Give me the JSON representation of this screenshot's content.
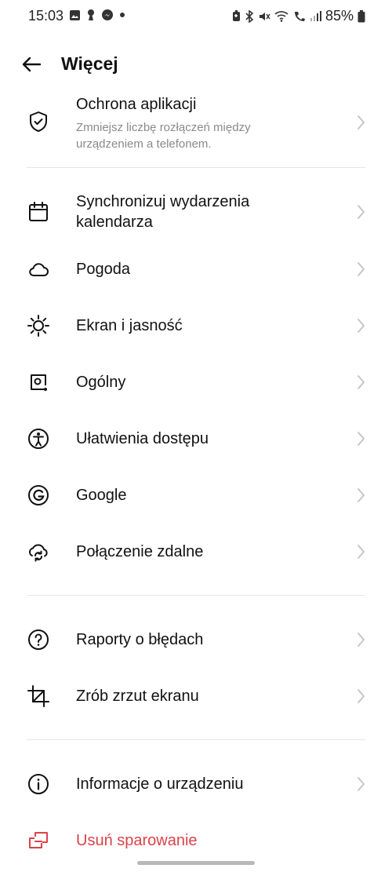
{
  "status_bar": {
    "time": "15:03",
    "battery_percent": "85%",
    "left_icons": [
      "image-icon",
      "keyhole-icon",
      "messenger-icon",
      "dot-icon"
    ],
    "right_icons": [
      "battery-saver-icon",
      "bluetooth-icon",
      "mute-icon",
      "wifi-icon",
      "wifi-call-icon",
      "signal-icon",
      "battery-icon"
    ]
  },
  "header": {
    "title": "Więcej",
    "back_icon": "back-arrow-icon"
  },
  "items": [
    {
      "id": "app-protection",
      "label": "Ochrona aplikacji",
      "sub": "Zmniejsz liczbę rozłączeń między urządzeniem a telefonem.",
      "icon": "shield-icon"
    },
    {
      "id": "calendar-sync",
      "label": "Synchronizuj wydarzenia kalendarza",
      "icon": "calendar-icon"
    },
    {
      "id": "weather",
      "label": "Pogoda",
      "icon": "cloud-icon"
    },
    {
      "id": "display",
      "label": "Ekran i jasność",
      "icon": "sun-icon"
    },
    {
      "id": "general",
      "label": "Ogólny",
      "icon": "general-settings-icon"
    },
    {
      "id": "accessibility",
      "label": "Ułatwienia dostępu",
      "icon": "accessibility-icon"
    },
    {
      "id": "google",
      "label": "Google",
      "icon": "google-icon"
    },
    {
      "id": "remote",
      "label": "Połączenie zdalne",
      "icon": "cloud-sync-icon"
    },
    {
      "id": "bug-report",
      "label": "Raporty o błędach",
      "icon": "question-icon"
    },
    {
      "id": "screenshot",
      "label": "Zrób zrzut ekranu",
      "icon": "crop-icon"
    },
    {
      "id": "device-info",
      "label": "Informacje o urządzeniu",
      "icon": "info-icon"
    },
    {
      "id": "unpair",
      "label": "Usuń sparowanie",
      "icon": "unpair-icon",
      "color": "#d9434a"
    }
  ]
}
